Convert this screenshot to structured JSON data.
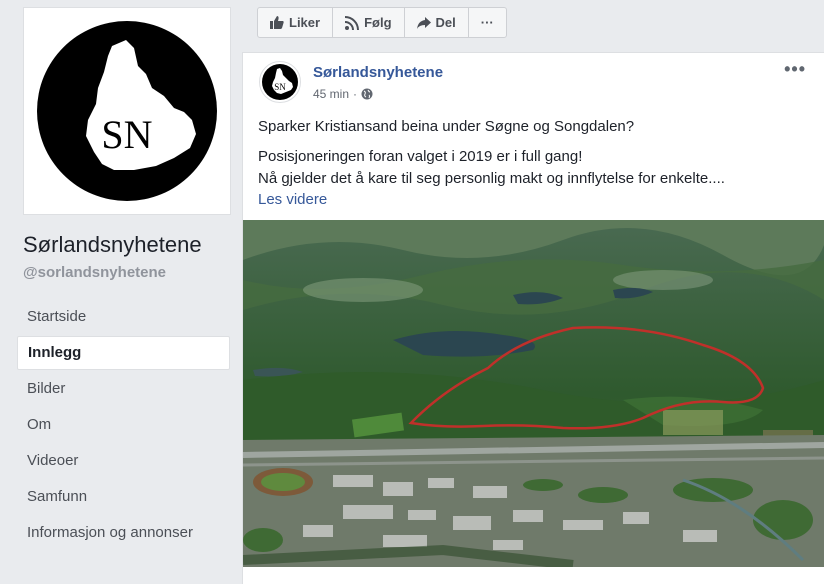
{
  "page": {
    "name": "Sørlandsnyhetene",
    "handle": "@sorlandsnyhetene",
    "logo_text": "SN"
  },
  "nav": {
    "items": [
      {
        "label": "Startside"
      },
      {
        "label": "Innlegg"
      },
      {
        "label": "Bilder"
      },
      {
        "label": "Om"
      },
      {
        "label": "Videoer"
      },
      {
        "label": "Samfunn"
      },
      {
        "label": "Informasjon og annonser"
      }
    ],
    "active": "Innlegg"
  },
  "toolbar": {
    "like_label": "Liker",
    "follow_label": "Følg",
    "share_label": "Del",
    "more_label": "···"
  },
  "post": {
    "author": "Sørlandsnyhetene",
    "time": "45 min",
    "separator": "·",
    "privacy_icon": "globe-icon",
    "more_label": "•••",
    "headline": "Sparker Kristiansand beina under Søgne og Songdalen?",
    "body_line1": "Posisjoneringen foran valget i 2019 er i full gang!",
    "body_line2": "Nå gjelder det å kare til seg personlig makt og innflytelse for enkelte....",
    "read_more": "Les videre"
  },
  "colors": {
    "link_blue": "#365899",
    "bg": "#e9ebee",
    "outline_red": "#c0302a"
  }
}
